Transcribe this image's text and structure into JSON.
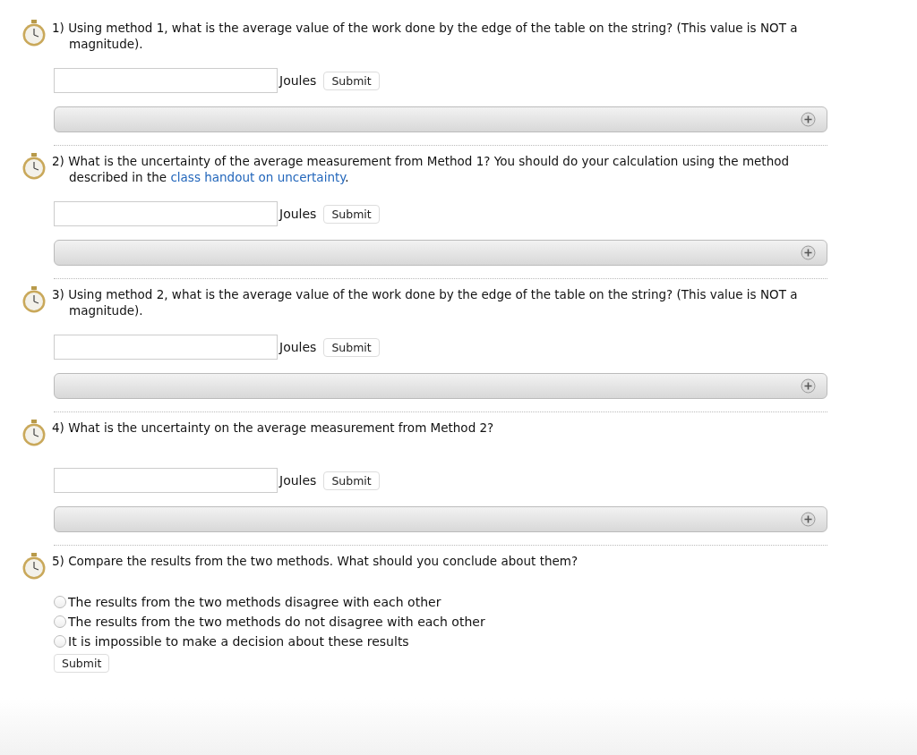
{
  "questions": [
    {
      "kind": "numeric",
      "number": "1)",
      "text": [
        {
          "kind": "text",
          "text": "Using method 1, what is the average value of the work done by the edge of the table on the string? (This value is NOT a magnitude)."
        }
      ],
      "unit": "Joules",
      "submit": "Submit"
    },
    {
      "kind": "numeric",
      "number": "2)",
      "text": [
        {
          "kind": "text",
          "text": "What is the uncertainty of the average measurement from Method 1? You should do your calculation using the method described in the "
        },
        {
          "kind": "link",
          "text": "class handout on uncertainty"
        },
        {
          "kind": "text",
          "text": "."
        }
      ],
      "unit": "Joules",
      "submit": "Submit"
    },
    {
      "kind": "numeric",
      "number": "3)",
      "text": [
        {
          "kind": "text",
          "text": "Using method 2, what is the average value of the work done by the edge of the table on the string? (This value is NOT a magnitude)."
        }
      ],
      "unit": "Joules",
      "submit": "Submit"
    },
    {
      "kind": "numeric",
      "number": "4)",
      "text": [
        {
          "kind": "text",
          "text": "What is the uncertainty on the average measurement from Method 2?"
        }
      ],
      "unit": "Joules",
      "submit": "Submit"
    },
    {
      "kind": "choice",
      "number": "5)",
      "text": [
        {
          "kind": "text",
          "text": "Compare the results from the two methods. What should you conclude about them?"
        }
      ],
      "options": [
        {
          "label": "The results from the two methods disagree with each other",
          "selected": false
        },
        {
          "label": "The results from the two methods do not disagree with each other",
          "selected": false
        },
        {
          "label": "It is impossible to make a decision about these results",
          "selected": false
        }
      ],
      "submit": "Submit"
    }
  ]
}
